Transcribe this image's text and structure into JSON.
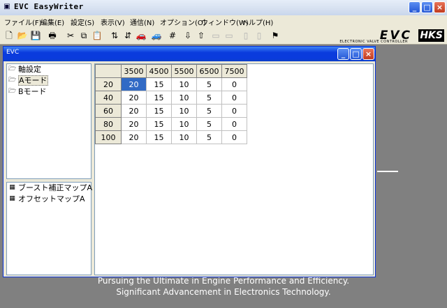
{
  "app": {
    "title": "EVC EasyWriter",
    "icon": "evc-app-icon",
    "window_buttons": [
      "minimize",
      "maximize",
      "close"
    ]
  },
  "menu": [
    "ファイル(F)",
    "編集(E)",
    "設定(S)",
    "表示(V)",
    "通信(N)",
    "オプション(O)",
    "ウィンドウ(W)",
    "ヘルプ(H)"
  ],
  "toolbar": {
    "buttons": [
      "new-icon",
      "open-icon",
      "save-icon",
      "print-icon",
      "cut-icon",
      "copy-icon",
      "paste-icon",
      "sort-icon",
      "sort-icon",
      "car-icon",
      "grid-icon",
      "write-icon",
      "read-icon",
      "monitor-icon",
      "monitor-icon",
      "panel-icon",
      "panel-icon",
      "flag-icon"
    ],
    "logo_main": "EVC",
    "logo_sub": "ELECTRONIC VALVE CONTROLLER",
    "logo_brand": "HKS"
  },
  "workspace": {
    "tagline_line1": "Pursuing the Ultimate in Engine Performance and Efficiency.",
    "tagline_line2": "Significant Advancement in Electronics Technology."
  },
  "child_window": {
    "title": "",
    "tree_top": [
      {
        "label": "軸設定",
        "selected": false
      },
      {
        "label": "Aモード",
        "selected": true
      },
      {
        "label": "Bモード",
        "selected": false
      }
    ],
    "tree_bottom": [
      {
        "label": "ブースト補正マップA"
      },
      {
        "label": "オフセットマップA"
      }
    ],
    "table": {
      "columns": [
        "3500",
        "4500",
        "5500",
        "6500",
        "7500"
      ],
      "rows": [
        {
          "label": "20",
          "values": [
            "20",
            "15",
            "10",
            "5",
            "0"
          ]
        },
        {
          "label": "40",
          "values": [
            "20",
            "15",
            "10",
            "5",
            "0"
          ]
        },
        {
          "label": "60",
          "values": [
            "20",
            "15",
            "10",
            "5",
            "0"
          ]
        },
        {
          "label": "80",
          "values": [
            "20",
            "15",
            "10",
            "5",
            "0"
          ]
        },
        {
          "label": "100",
          "values": [
            "20",
            "15",
            "10",
            "5",
            "0"
          ]
        }
      ],
      "selected_cell": {
        "row": 0,
        "col": 0
      }
    }
  },
  "colors": {
    "title_active": "#0a3bdd",
    "workspace_bg": "#808080",
    "selection": "#316ac5"
  }
}
